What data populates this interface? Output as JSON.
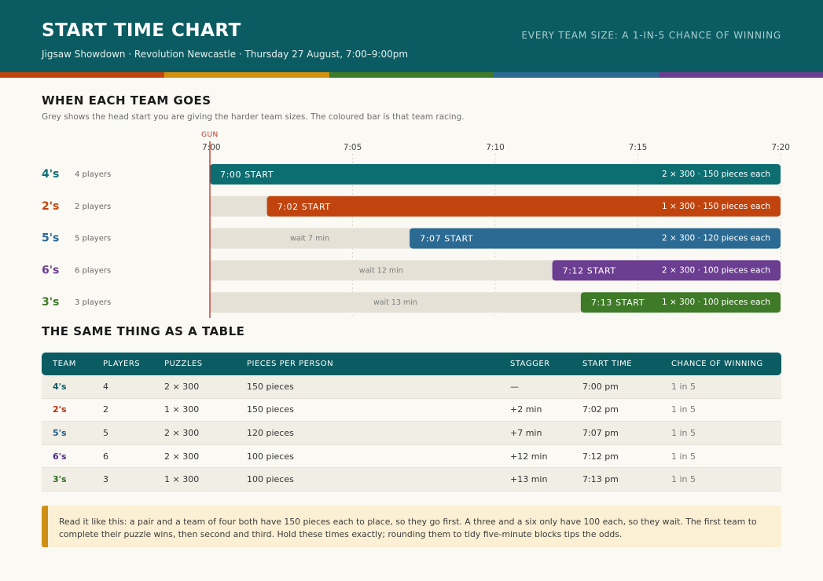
{
  "header": {
    "title": "START TIME CHART",
    "subtitle": "Jigsaw Showdown  ·  Revolution Newcastle  ·  Thursday 27 August, 7:00–9:00pm",
    "tagline": "EVERY TEAM SIZE: A 1-IN-5 CHANCE OF WINNING",
    "background": "#0b5c62"
  },
  "stripe_colors": [
    "#c1440e",
    "#d4900f",
    "#3f7a28",
    "#2a6a93",
    "#6b3e91"
  ],
  "gantt_section": {
    "heading": "WHEN EACH TEAM GOES",
    "description": "Grey shows the head start you are giving the harder team sizes. The coloured bar is that team racing."
  },
  "chart_data": {
    "type": "bar",
    "orientation": "horizontal-gantt",
    "gun_label": "GUN",
    "gun_time": "7:00",
    "x_ticks": [
      "7:00",
      "7:05",
      "7:10",
      "7:15",
      "7:20"
    ],
    "x_range_minutes_after_7pm": [
      0,
      20
    ],
    "wait_color": "#e5e1d6",
    "gun_color": "#c0392b",
    "series": [
      {
        "team": "4's",
        "players": "4 players",
        "start_minute": 0,
        "start_label": "7:00  START",
        "wait_label": "",
        "detail": "2 × 300  ·  150 pieces each",
        "color": "#0d6e72"
      },
      {
        "team": "2's",
        "players": "2 players",
        "start_minute": 2,
        "start_label": "7:02  START",
        "wait_label": "",
        "detail": "1 × 300  ·  150 pieces each",
        "color": "#c1440e"
      },
      {
        "team": "5's",
        "players": "5 players",
        "start_minute": 7,
        "start_label": "7:07  START",
        "wait_label": "wait 7 min",
        "detail": "2 × 300  ·  120 pieces each",
        "color": "#2a6a93"
      },
      {
        "team": "6's",
        "players": "6 players",
        "start_minute": 12,
        "start_label": "7:12  START",
        "wait_label": "wait 12 min",
        "detail": "2 × 300  ·  100 pieces each",
        "color": "#6b3e91"
      },
      {
        "team": "3's",
        "players": "3 players",
        "start_minute": 13,
        "start_label": "7:13  START",
        "wait_label": "wait 13 min",
        "detail": "1 × 300  ·  100 pieces each",
        "color": "#3f7a28"
      }
    ]
  },
  "table_section": {
    "heading": "THE SAME THING AS A TABLE",
    "columns": [
      "TEAM",
      "PLAYERS",
      "PUZZLES",
      "PIECES PER PERSON",
      "STAGGER",
      "START TIME",
      "CHANCE OF WINNING"
    ],
    "rows": [
      {
        "team": "4's",
        "players": "4",
        "puzzles": "2 × 300",
        "pieces": "150 pieces",
        "stagger": "—",
        "start": "7:00 pm",
        "chance": "1 in 5",
        "color": "#0b5c62"
      },
      {
        "team": "2's",
        "players": "2",
        "puzzles": "1 × 300",
        "pieces": "150 pieces",
        "stagger": "+2 min",
        "start": "7:02 pm",
        "chance": "1 in 5",
        "color": "#b3300f"
      },
      {
        "team": "5's",
        "players": "5",
        "puzzles": "2 × 300",
        "pieces": "120 pieces",
        "stagger": "+7 min",
        "start": "7:07 pm",
        "chance": "1 in 5",
        "color": "#1e5b82"
      },
      {
        "team": "6's",
        "players": "6",
        "puzzles": "2 × 300",
        "pieces": "100 pieces",
        "stagger": "+12 min",
        "start": "7:12 pm",
        "chance": "1 in 5",
        "color": "#4b2a7a"
      },
      {
        "team": "3's",
        "players": "3",
        "puzzles": "1 × 300",
        "pieces": "100 pieces",
        "stagger": "+13 min",
        "start": "7:13 pm",
        "chance": "1 in 5",
        "color": "#2f6b1e"
      }
    ]
  },
  "note": {
    "text": "Read it like this: a pair and a team of four both have 150 pieces each to place, so they go first. A three and a six only have 100 each, so they wait. The first team to complete their puzzle wins, then second and third. Hold these times exactly; rounding them to tidy five-minute blocks tips the odds.",
    "accent_color": "#cf8f14"
  }
}
